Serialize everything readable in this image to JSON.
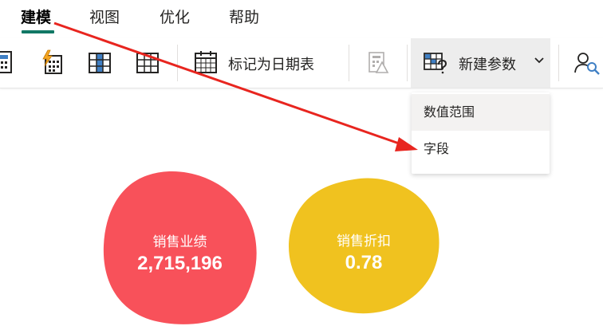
{
  "ribbon": {
    "tabs": [
      {
        "label": "建模",
        "active": true
      },
      {
        "label": "视图",
        "active": false
      },
      {
        "label": "优化",
        "active": false
      },
      {
        "label": "帮助",
        "active": false
      }
    ],
    "accent_color": "#117865"
  },
  "toolbar": {
    "mark_as_date_table_label": "标记为日期表",
    "new_parameter_label": "新建参数"
  },
  "new_parameter_menu": {
    "items": [
      "数值范围",
      "字段"
    ]
  },
  "cards": [
    {
      "label": "销售业绩",
      "value": "2,715,196",
      "color": "#f8515a"
    },
    {
      "label": "销售折扣",
      "value": "0.78",
      "color": "#f0c21f"
    }
  ],
  "annotation": {
    "arrow_color": "#e8251f"
  }
}
